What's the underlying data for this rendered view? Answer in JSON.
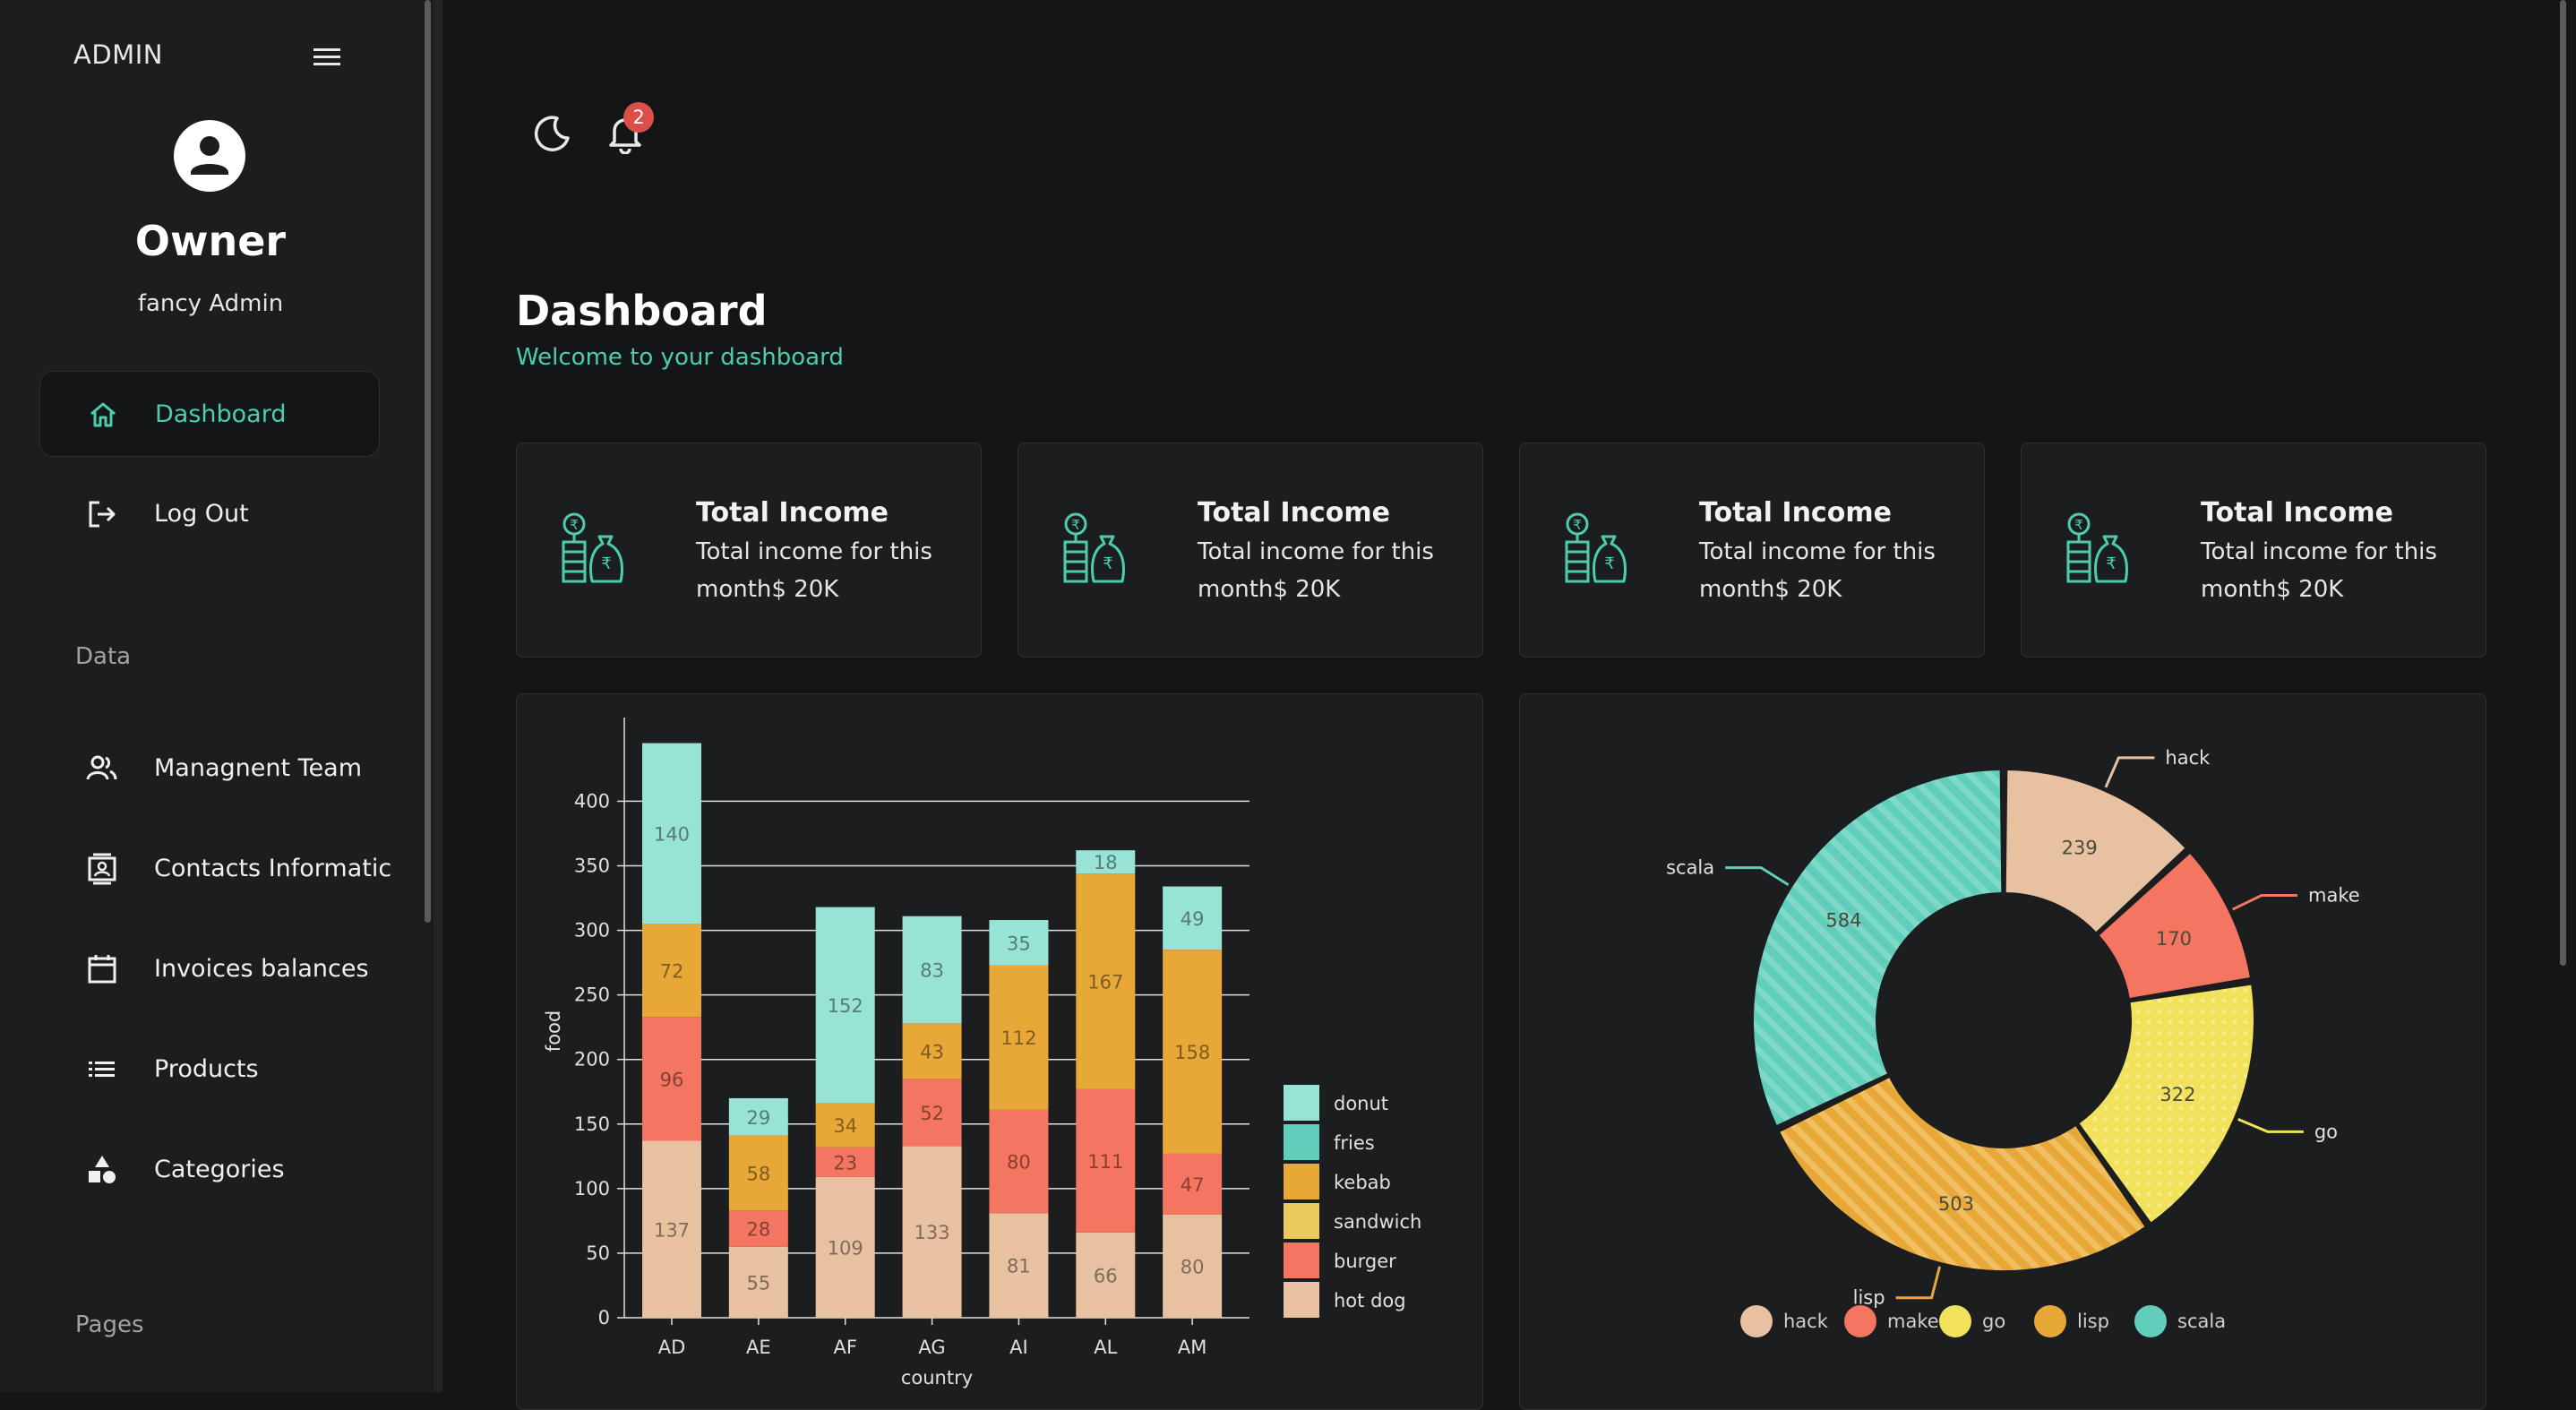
{
  "sidebar": {
    "brand": "ADMIN",
    "profile": {
      "name": "Owner",
      "role": "fancy Admin"
    },
    "nav_top": [
      {
        "label": "Dashboard",
        "icon": "home-icon",
        "active": true
      },
      {
        "label": "Log Out",
        "icon": "logout-icon",
        "active": false
      }
    ],
    "section_data": "Data",
    "nav_data": [
      {
        "label": "Managnent Team",
        "icon": "people-icon"
      },
      {
        "label": "Contacts Informatic",
        "icon": "contacts-icon"
      },
      {
        "label": "Invoices balances",
        "icon": "calendar-icon"
      },
      {
        "label": "Products",
        "icon": "list-icon"
      },
      {
        "label": "Categories",
        "icon": "shapes-icon"
      }
    ],
    "section_pages": "Pages"
  },
  "topbar": {
    "notification_count": "2"
  },
  "header": {
    "title": "Dashboard",
    "subtitle": "Welcome to your dashboard"
  },
  "stats": [
    {
      "title": "Total Income",
      "desc": "Total income for this month$ 20K",
      "icon": "money-bags-icon"
    },
    {
      "title": "Total Income",
      "desc": "Total income for this month$ 20K",
      "icon": "money-bags-icon"
    },
    {
      "title": "Total Income",
      "desc": "Total income for this month$ 20K",
      "icon": "money-bags-icon"
    },
    {
      "title": "Total Income",
      "desc": "Total income for this month$ 20K",
      "icon": "money-bags-icon"
    }
  ],
  "colors": {
    "accent": "#4cceac",
    "hot dog": "#e8c1a0",
    "burger": "#f47560",
    "sandwich": "#e8c95a",
    "kebab": "#e8a838",
    "fries": "#61cdbb",
    "donut": "#97e3d5",
    "hack": "#e8c1a0",
    "make": "#f47560",
    "go": "#f1e15b",
    "lisp": "#e8a838",
    "scala": "#61cdbb"
  },
  "chart_data": [
    {
      "type": "bar",
      "stacked": true,
      "categories": [
        "AD",
        "AE",
        "AF",
        "AG",
        "AI",
        "AL",
        "AM"
      ],
      "series": [
        {
          "name": "hot dog",
          "values": [
            137,
            55,
            109,
            133,
            81,
            66,
            80
          ]
        },
        {
          "name": "burger",
          "values": [
            96,
            28,
            23,
            52,
            80,
            111,
            47
          ]
        },
        {
          "name": "sandwich",
          "values": [
            null,
            null,
            null,
            null,
            null,
            null,
            null
          ]
        },
        {
          "name": "kebab",
          "values": [
            72,
            58,
            34,
            43,
            112,
            167,
            158
          ]
        },
        {
          "name": "fries",
          "values": [
            null,
            null,
            null,
            null,
            null,
            null,
            null
          ]
        },
        {
          "name": "donut",
          "values": [
            140,
            29,
            152,
            83,
            35,
            18,
            49
          ]
        }
      ],
      "legend": [
        "donut",
        "fries",
        "kebab",
        "sandwich",
        "burger",
        "hot dog"
      ],
      "legend_position": "right",
      "xlabel": "country",
      "ylabel": "food",
      "ylim": [
        0,
        400
      ],
      "yticks": [
        0,
        50,
        100,
        150,
        200,
        250,
        300,
        350,
        400
      ],
      "grid": true
    },
    {
      "type": "pie",
      "donut": true,
      "slices": [
        {
          "label": "hack",
          "value": 239
        },
        {
          "label": "make",
          "value": 170
        },
        {
          "label": "go",
          "value": 322
        },
        {
          "label": "lisp",
          "value": 503
        },
        {
          "label": "scala",
          "value": 584
        }
      ],
      "legend": [
        "hack",
        "make",
        "go",
        "lisp",
        "scala"
      ],
      "legend_position": "bottom"
    }
  ]
}
